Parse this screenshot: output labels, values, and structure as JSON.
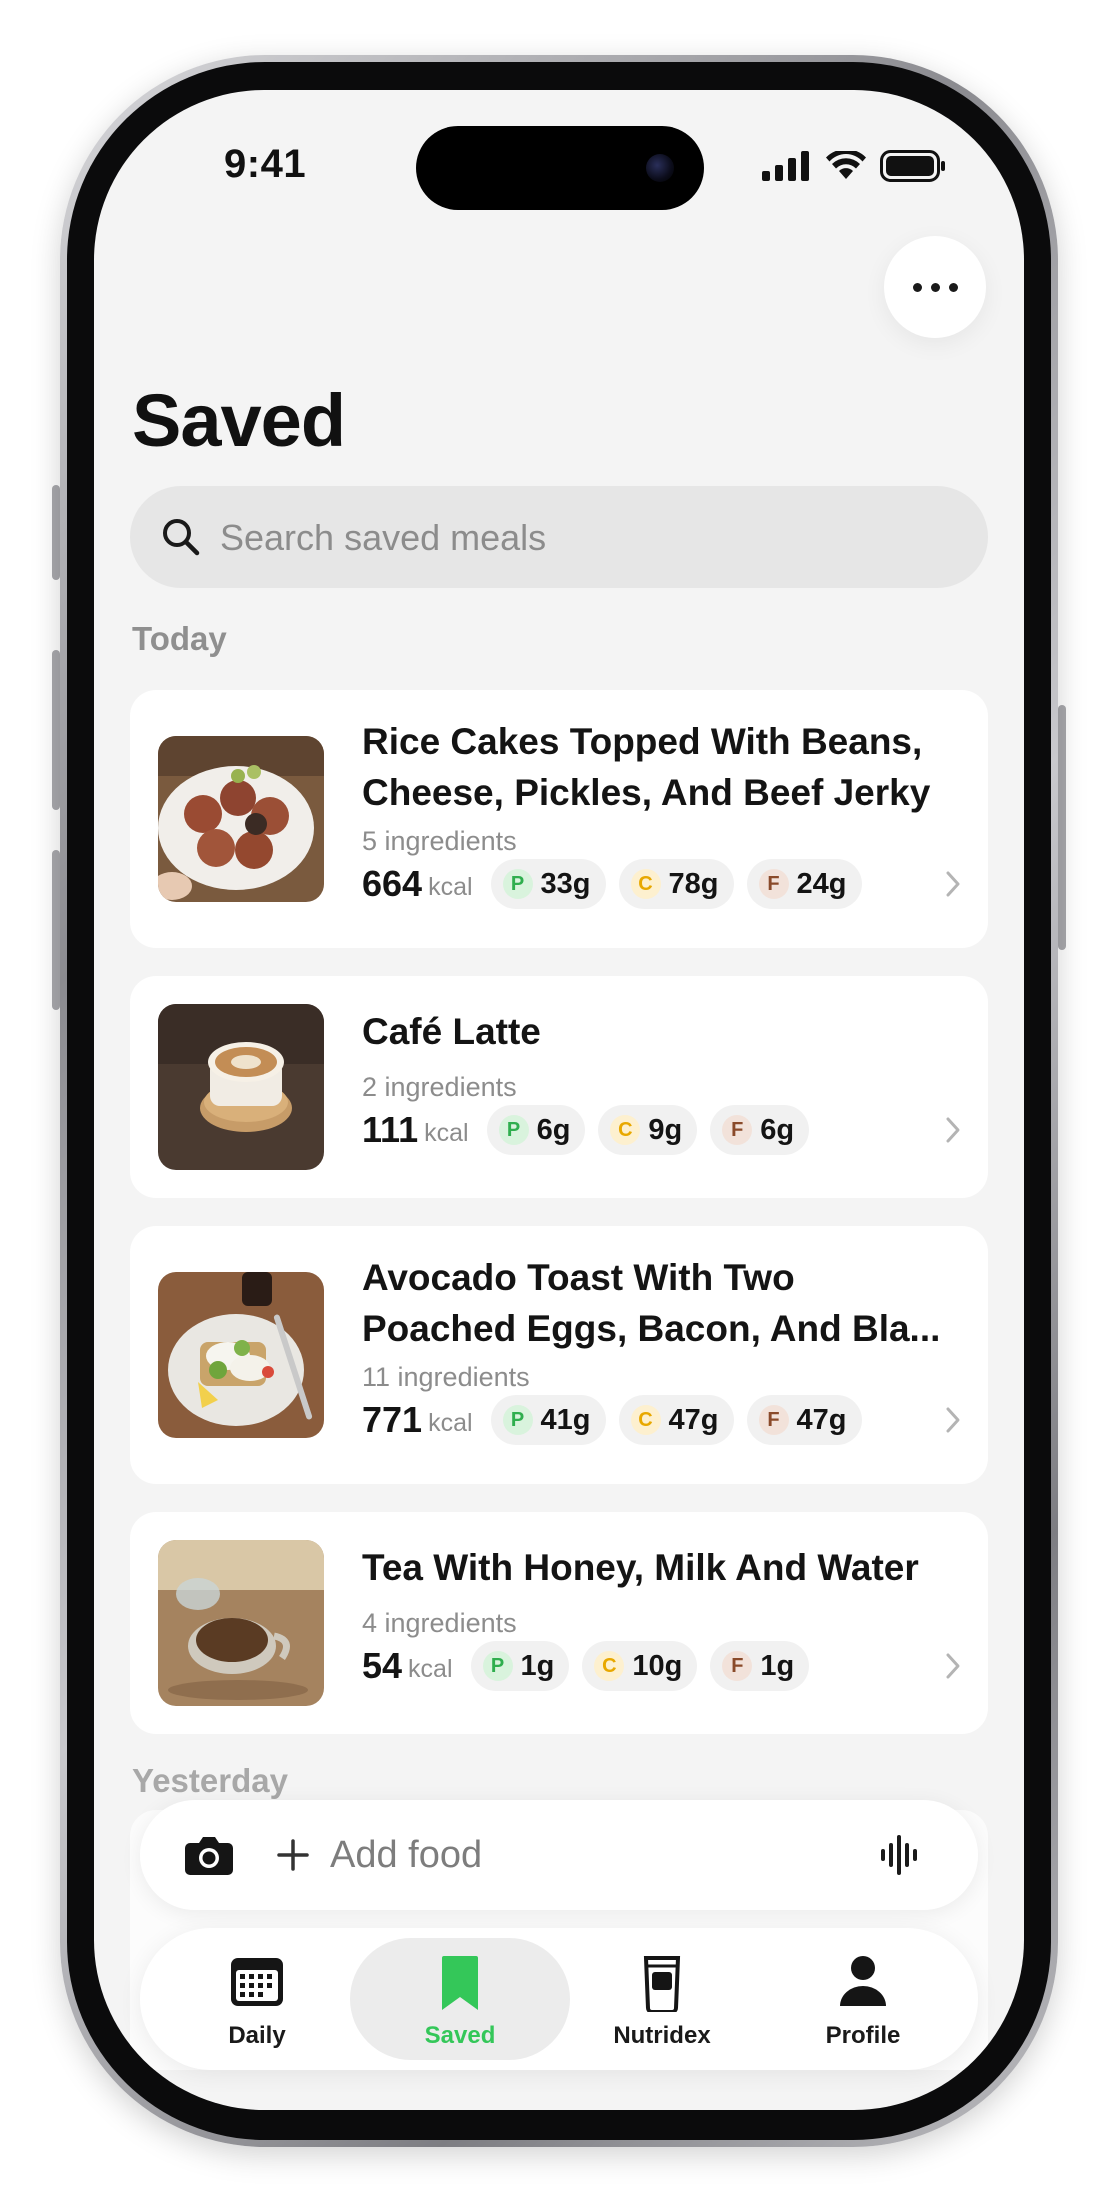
{
  "status_bar": {
    "time": "9:41"
  },
  "header": {
    "title": "Saved"
  },
  "search": {
    "placeholder": "Search saved meals"
  },
  "sections": {
    "today": "Today",
    "yesterday": "Yesterday"
  },
  "meals": [
    {
      "title_line1": "Rice Cakes Topped With Beans,",
      "title_line2": "Cheese, Pickles, And Beef Jerky",
      "ingredients": "5 ingredients",
      "kcal": "664",
      "kcal_unit": "kcal",
      "protein": "33g",
      "carbs": "78g",
      "fat": "24g",
      "thumb_icon": "rice-cakes-photo"
    },
    {
      "title_line1": "Café Latte",
      "title_line2": "",
      "ingredients": "2 ingredients",
      "kcal": "111",
      "kcal_unit": "kcal",
      "protein": "6g",
      "carbs": "9g",
      "fat": "6g",
      "thumb_icon": "latte-photo"
    },
    {
      "title_line1": "Avocado Toast With Two",
      "title_line2": "Poached Eggs, Bacon, And Bla...",
      "ingredients": "11 ingredients",
      "kcal": "771",
      "kcal_unit": "kcal",
      "protein": "41g",
      "carbs": "47g",
      "fat": "47g",
      "thumb_icon": "avocado-toast-photo"
    },
    {
      "title_line1": "Tea With Honey, Milk And Water",
      "title_line2": "",
      "ingredients": "4 ingredients",
      "kcal": "54",
      "kcal_unit": "kcal",
      "protein": "1g",
      "carbs": "10g",
      "fat": "1g",
      "thumb_icon": "tea-photo"
    }
  ],
  "macro_letters": {
    "protein": "P",
    "carbs": "C",
    "fat": "F"
  },
  "colors": {
    "accent_green": "#34c759",
    "protein_bg": "#d9f3dd",
    "protein_fg": "#2fae4e",
    "carbs_bg": "#fdf0cf",
    "carbs_fg": "#e8a800",
    "fat_bg": "#f2e2da",
    "fat_fg": "#8a4a2a"
  },
  "add_food": {
    "label": "Add food"
  },
  "tabs": [
    {
      "label": "Daily",
      "icon": "calendar-icon",
      "active": false
    },
    {
      "label": "Saved",
      "icon": "bookmark-icon",
      "active": true
    },
    {
      "label": "Nutridex",
      "icon": "nutridex-icon",
      "active": false
    },
    {
      "label": "Profile",
      "icon": "person-icon",
      "active": false
    }
  ]
}
